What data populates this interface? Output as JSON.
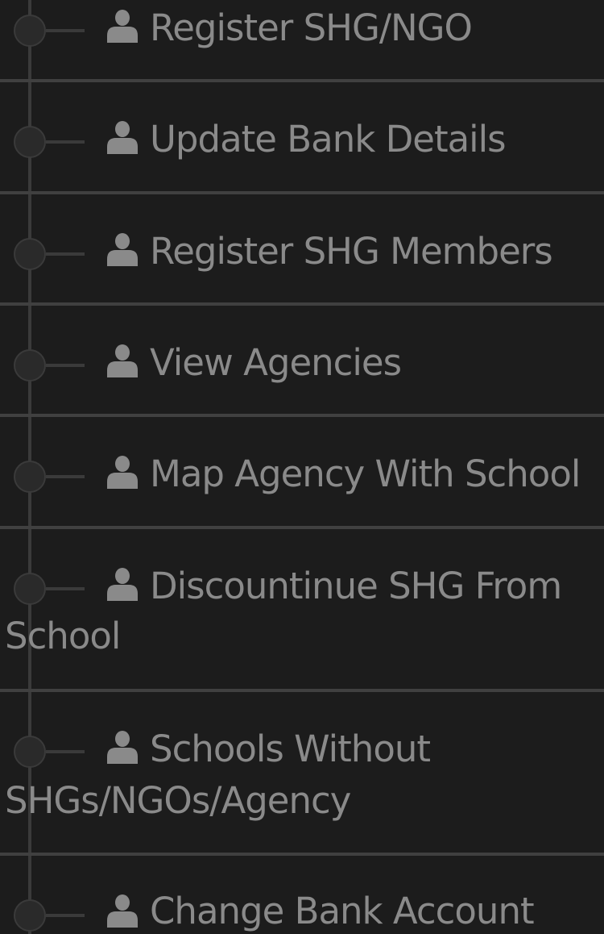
{
  "menu": {
    "items": [
      {
        "label": "Register SHG/NGO",
        "icon": "user-icon"
      },
      {
        "label": "Update Bank Details",
        "icon": "user-icon"
      },
      {
        "label": "Register SHG Members",
        "icon": "user-icon"
      },
      {
        "label": "View Agencies",
        "icon": "user-icon"
      },
      {
        "label": "Map Agency With School",
        "icon": "user-icon"
      },
      {
        "label": "Discountinue SHG From",
        "label_cont": "School",
        "icon": "user-icon"
      },
      {
        "label": "Schools Without",
        "label_cont": "SHGs/NGOs/Agency",
        "icon": "user-icon"
      },
      {
        "label": "Change Bank Account",
        "icon": "user-icon"
      }
    ]
  }
}
